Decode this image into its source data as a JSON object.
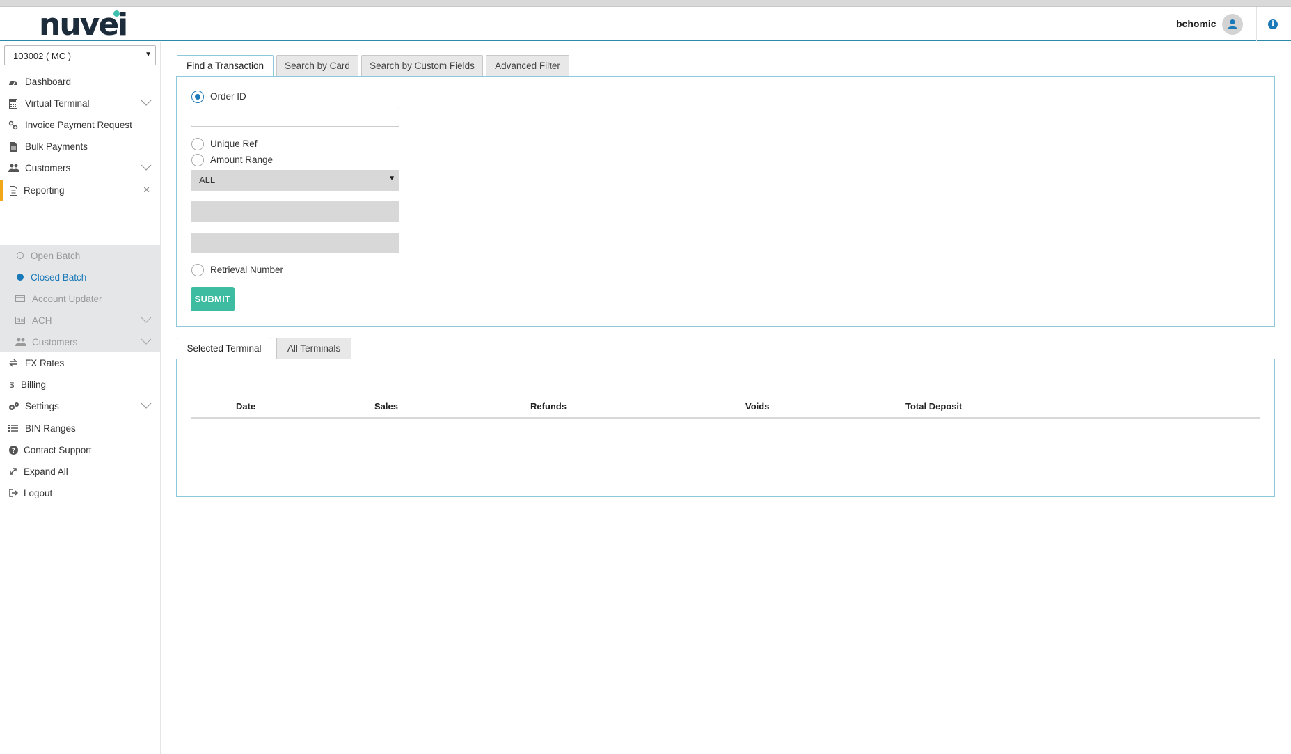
{
  "header": {
    "logo_text": "nuvei",
    "username": "bchomic"
  },
  "sidebar": {
    "merchant": "103002 ( MC )",
    "items": [
      {
        "label": "Dashboard"
      },
      {
        "label": "Virtual Terminal"
      },
      {
        "label": "Invoice Payment Request"
      },
      {
        "label": "Bulk Payments"
      },
      {
        "label": "Customers"
      },
      {
        "label": "Reporting"
      },
      {
        "label": "FX Rates"
      },
      {
        "label": "Billing"
      },
      {
        "label": "Settings"
      },
      {
        "label": "BIN Ranges"
      },
      {
        "label": "Contact Support"
      },
      {
        "label": "Expand All"
      },
      {
        "label": "Logout"
      }
    ],
    "reporting_sub": [
      {
        "label": "Open Batch"
      },
      {
        "label": "Closed Batch"
      },
      {
        "label": "Account Updater"
      },
      {
        "label": "ACH"
      },
      {
        "label": "Customers"
      }
    ]
  },
  "search_tabs": [
    {
      "label": "Find a Transaction"
    },
    {
      "label": "Search by Card"
    },
    {
      "label": "Search by Custom Fields"
    },
    {
      "label": "Advanced Filter"
    }
  ],
  "search_form": {
    "order_id_label": "Order ID",
    "order_id_value": "",
    "unique_ref_label": "Unique Ref",
    "amount_range_label": "Amount Range",
    "amount_select_value": "ALL",
    "retrieval_label": "Retrieval Number",
    "submit_label": "SUBMIT"
  },
  "terminal_tabs": [
    {
      "label": "Selected Terminal"
    },
    {
      "label": "All Terminals"
    }
  ],
  "summary_table": {
    "columns": [
      "Date",
      "Sales",
      "Refunds",
      "Voids",
      "Total Deposit"
    ]
  },
  "colors": {
    "accent": "#1a79b8",
    "submit": "#3dbca2",
    "active_marker": "#f0a818",
    "panel_border": "#8ec9db"
  }
}
